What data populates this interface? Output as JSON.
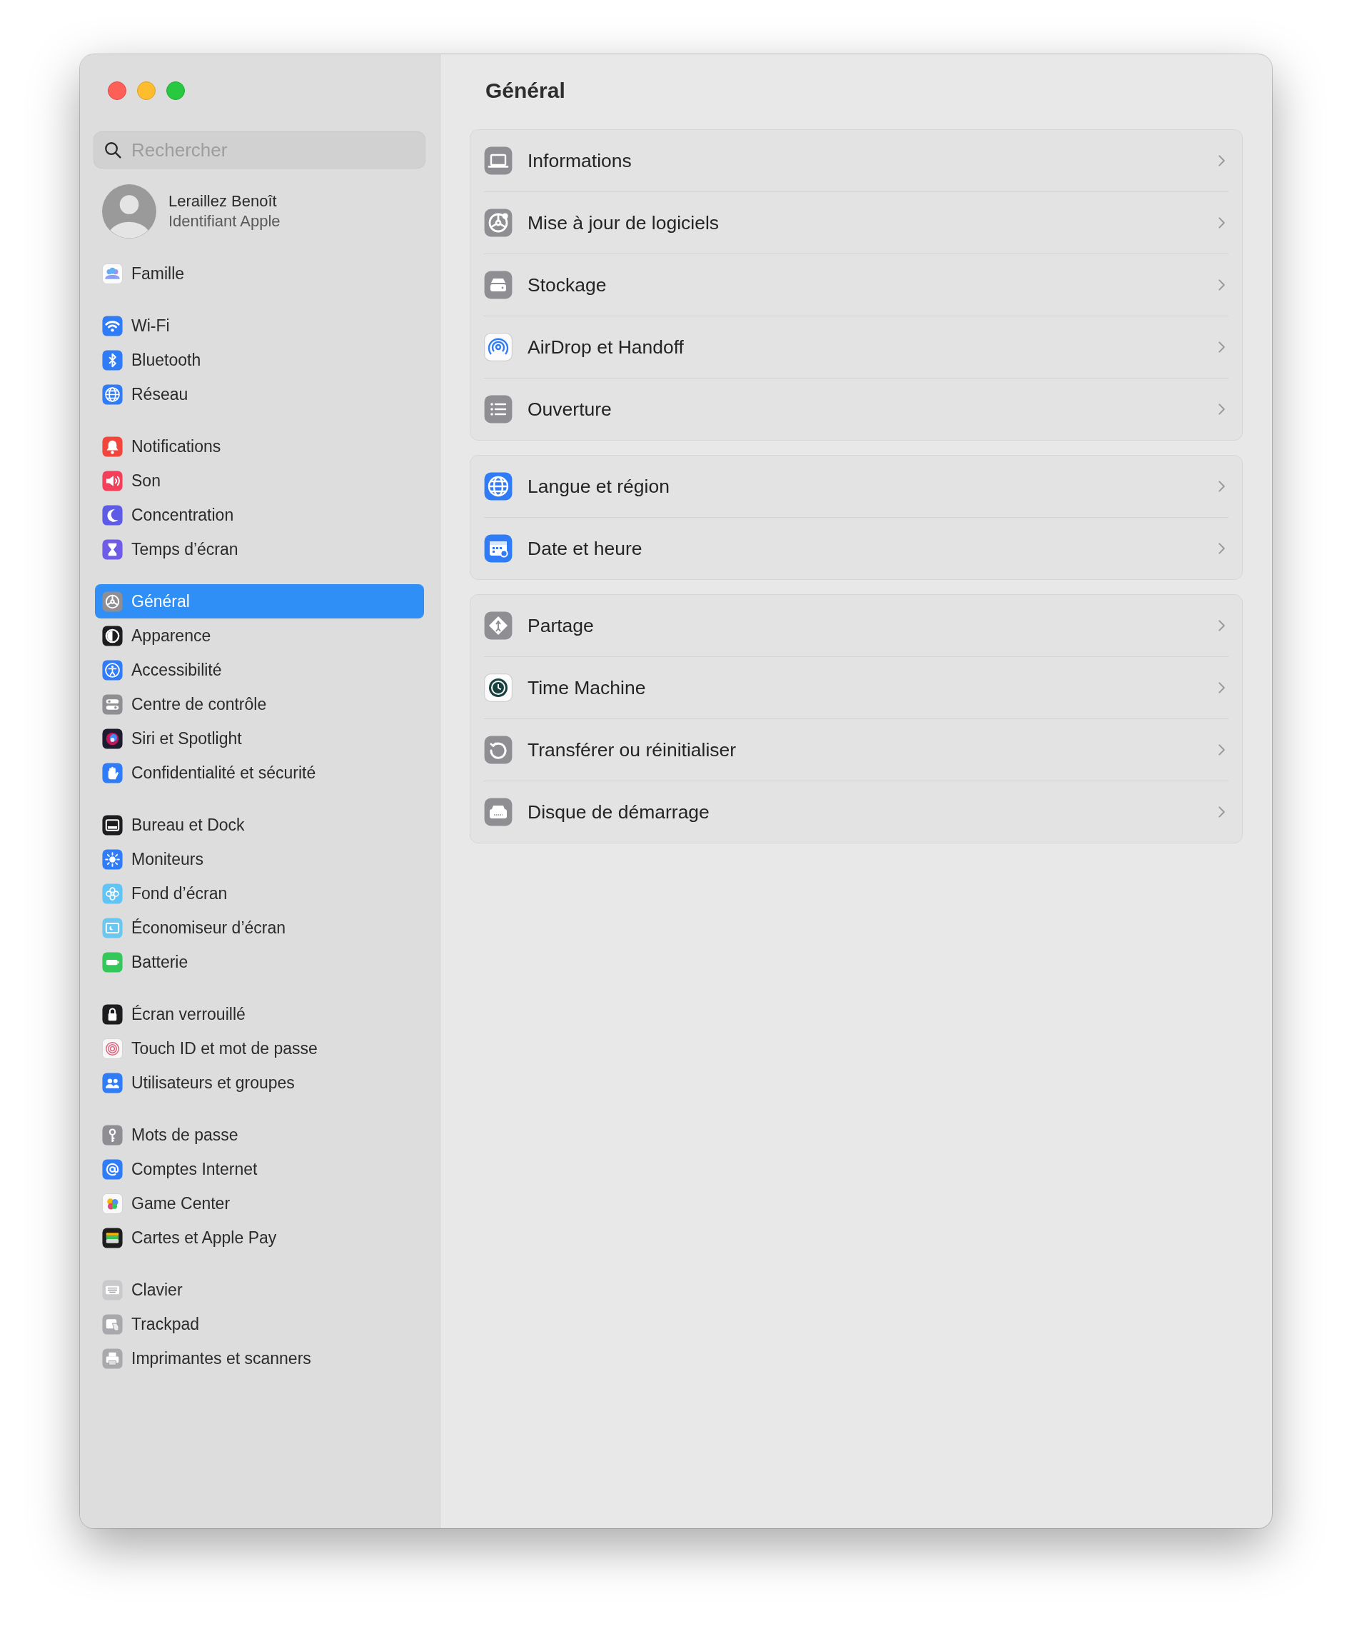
{
  "sidebar": {
    "search": {
      "placeholder": "Rechercher"
    },
    "account": {
      "name": "Leraillez Benoît",
      "subtitle": "Identifiant Apple"
    },
    "groups": [
      {
        "items": [
          {
            "label": "Famille",
            "selected": false
          }
        ]
      },
      {
        "items": [
          {
            "label": "Wi-Fi",
            "selected": false
          },
          {
            "label": "Bluetooth",
            "selected": false
          },
          {
            "label": "Réseau",
            "selected": false
          }
        ]
      },
      {
        "items": [
          {
            "label": "Notifications",
            "selected": false
          },
          {
            "label": "Son",
            "selected": false
          },
          {
            "label": "Concentration",
            "selected": false
          },
          {
            "label": "Temps d’écran",
            "selected": false
          }
        ]
      },
      {
        "items": [
          {
            "label": "Général",
            "selected": true
          },
          {
            "label": "Apparence",
            "selected": false
          },
          {
            "label": "Accessibilité",
            "selected": false
          },
          {
            "label": "Centre de contrôle",
            "selected": false
          },
          {
            "label": "Siri et Spotlight",
            "selected": false
          },
          {
            "label": "Confidentialité et sécurité",
            "selected": false
          }
        ]
      },
      {
        "items": [
          {
            "label": "Bureau et Dock",
            "selected": false
          },
          {
            "label": "Moniteurs",
            "selected": false
          },
          {
            "label": "Fond d’écran",
            "selected": false
          },
          {
            "label": "Économiseur d’écran",
            "selected": false
          },
          {
            "label": "Batterie",
            "selected": false
          }
        ]
      },
      {
        "items": [
          {
            "label": "Écran verrouillé",
            "selected": false
          },
          {
            "label": "Touch ID et mot de passe",
            "selected": false
          },
          {
            "label": "Utilisateurs et groupes",
            "selected": false
          }
        ]
      },
      {
        "items": [
          {
            "label": "Mots de passe",
            "selected": false
          },
          {
            "label": "Comptes Internet",
            "selected": false
          },
          {
            "label": "Game Center",
            "selected": false
          },
          {
            "label": "Cartes et Apple Pay",
            "selected": false
          }
        ]
      },
      {
        "items": [
          {
            "label": "Clavier",
            "selected": false
          },
          {
            "label": "Trackpad",
            "selected": false
          },
          {
            "label": "Imprimantes et scanners",
            "selected": false
          }
        ]
      }
    ]
  },
  "main": {
    "title": "Général",
    "sections": [
      {
        "rows": [
          {
            "label": "Informations"
          },
          {
            "label": "Mise à jour de logiciels"
          },
          {
            "label": "Stockage"
          },
          {
            "label": "AirDrop et Handoff"
          },
          {
            "label": "Ouverture"
          }
        ]
      },
      {
        "rows": [
          {
            "label": "Langue et région"
          },
          {
            "label": "Date et heure"
          }
        ]
      },
      {
        "rows": [
          {
            "label": "Partage"
          },
          {
            "label": "Time Machine"
          },
          {
            "label": "Transférer ou réinitialiser"
          },
          {
            "label": "Disque de démarrage"
          }
        ]
      }
    ]
  }
}
